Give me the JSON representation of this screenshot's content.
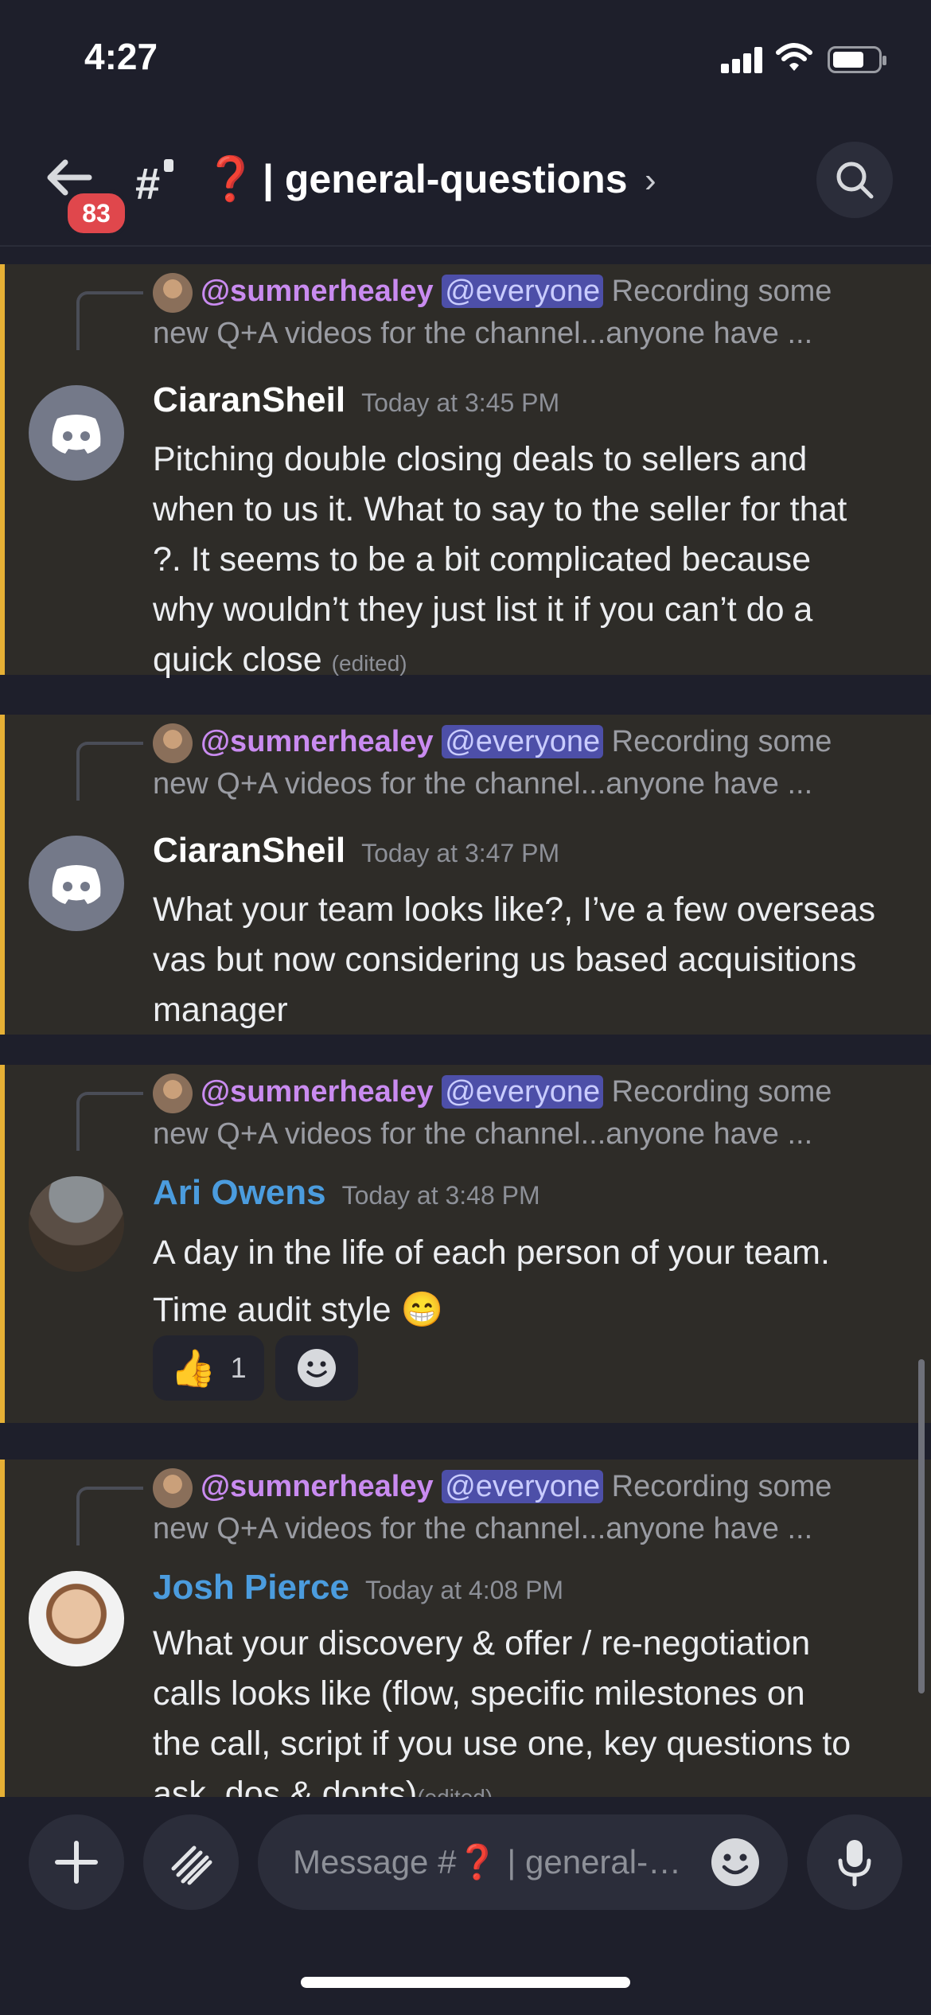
{
  "status_bar": {
    "time": "4:27"
  },
  "header": {
    "unread_badge": "83",
    "channel_prefix": "#",
    "channel_emoji": "❓",
    "channel_name": "| general-questions",
    "chevron": "›",
    "icons": [
      "back-arrow-icon",
      "hash-icon",
      "search-icon"
    ]
  },
  "reply_preview": {
    "author": "@sumnerhealey",
    "mention": "@everyone",
    "text_line1": "Recording some",
    "text_line2": "new Q+A videos for the channel...anyone have ..."
  },
  "messages": [
    {
      "author": "CiaranSheil",
      "timestamp": "Today at 3:45 PM",
      "lines": [
        "Pitching double closing deals to sellers and",
        "when to us it. What to say to the seller for that",
        "?. It seems to be a bit complicated because",
        "why wouldn’t they just list it if you can’t do a",
        "quick close"
      ],
      "edited": "(edited)"
    },
    {
      "author": "CiaranSheil",
      "timestamp": "Today at 3:47 PM",
      "lines": [
        "What your team looks like?, I’ve a few overseas",
        "vas but now considering us based acquisitions",
        "manager"
      ]
    },
    {
      "author": "Ari Owens",
      "timestamp": "Today at 3:48 PM",
      "lines": [
        "A day in the life of each person of your team.",
        "Time audit style 😁"
      ],
      "reactions": [
        {
          "emoji": "👍",
          "count": "1"
        }
      ]
    },
    {
      "author": "Josh Pierce",
      "timestamp": "Today at 4:08 PM",
      "lines": [
        "What your discovery & offer / re-negotiation",
        "calls looks like (flow, specific milestones on",
        "the call, script if you use one, key questions to",
        "ask, dos & donts)"
      ],
      "edited": "(edited)"
    }
  ],
  "composer": {
    "placeholder": "Message #❓ | general-questions",
    "icons": [
      "plus-icon",
      "apps-icon",
      "emoji-icon",
      "microphone-icon"
    ]
  },
  "colors": {
    "accent_bar": "#e6b035",
    "mention_bg": "#4d4fa8",
    "badge": "#e0474c",
    "name_blue": "#4b9cde",
    "name_pink": "#c98bf0"
  }
}
